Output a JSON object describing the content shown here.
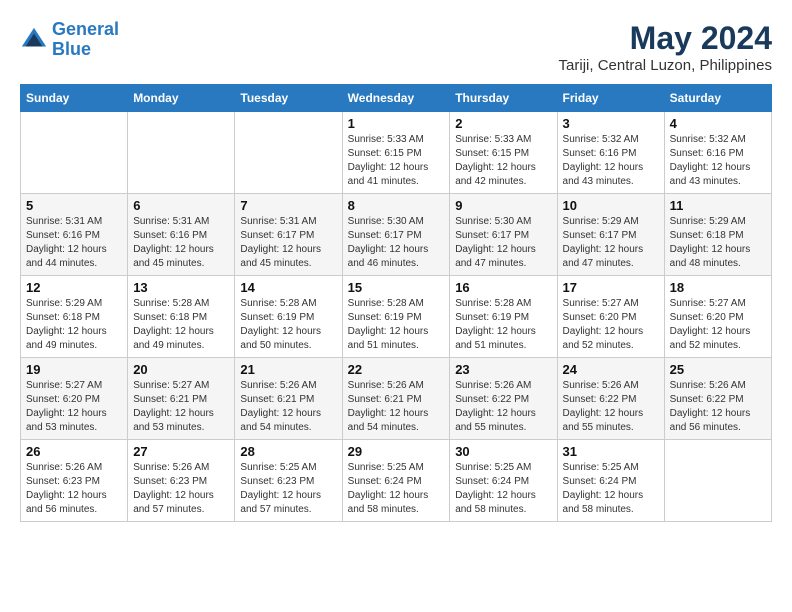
{
  "header": {
    "logo_line1": "General",
    "logo_line2": "Blue",
    "title": "May 2024",
    "subtitle": "Tariji, Central Luzon, Philippines"
  },
  "days_of_week": [
    "Sunday",
    "Monday",
    "Tuesday",
    "Wednesday",
    "Thursday",
    "Friday",
    "Saturday"
  ],
  "weeks": [
    [
      {
        "day": "",
        "info": ""
      },
      {
        "day": "",
        "info": ""
      },
      {
        "day": "",
        "info": ""
      },
      {
        "day": "1",
        "info": "Sunrise: 5:33 AM\nSunset: 6:15 PM\nDaylight: 12 hours\nand 41 minutes."
      },
      {
        "day": "2",
        "info": "Sunrise: 5:33 AM\nSunset: 6:15 PM\nDaylight: 12 hours\nand 42 minutes."
      },
      {
        "day": "3",
        "info": "Sunrise: 5:32 AM\nSunset: 6:16 PM\nDaylight: 12 hours\nand 43 minutes."
      },
      {
        "day": "4",
        "info": "Sunrise: 5:32 AM\nSunset: 6:16 PM\nDaylight: 12 hours\nand 43 minutes."
      }
    ],
    [
      {
        "day": "5",
        "info": "Sunrise: 5:31 AM\nSunset: 6:16 PM\nDaylight: 12 hours\nand 44 minutes."
      },
      {
        "day": "6",
        "info": "Sunrise: 5:31 AM\nSunset: 6:16 PM\nDaylight: 12 hours\nand 45 minutes."
      },
      {
        "day": "7",
        "info": "Sunrise: 5:31 AM\nSunset: 6:17 PM\nDaylight: 12 hours\nand 45 minutes."
      },
      {
        "day": "8",
        "info": "Sunrise: 5:30 AM\nSunset: 6:17 PM\nDaylight: 12 hours\nand 46 minutes."
      },
      {
        "day": "9",
        "info": "Sunrise: 5:30 AM\nSunset: 6:17 PM\nDaylight: 12 hours\nand 47 minutes."
      },
      {
        "day": "10",
        "info": "Sunrise: 5:29 AM\nSunset: 6:17 PM\nDaylight: 12 hours\nand 47 minutes."
      },
      {
        "day": "11",
        "info": "Sunrise: 5:29 AM\nSunset: 6:18 PM\nDaylight: 12 hours\nand 48 minutes."
      }
    ],
    [
      {
        "day": "12",
        "info": "Sunrise: 5:29 AM\nSunset: 6:18 PM\nDaylight: 12 hours\nand 49 minutes."
      },
      {
        "day": "13",
        "info": "Sunrise: 5:28 AM\nSunset: 6:18 PM\nDaylight: 12 hours\nand 49 minutes."
      },
      {
        "day": "14",
        "info": "Sunrise: 5:28 AM\nSunset: 6:19 PM\nDaylight: 12 hours\nand 50 minutes."
      },
      {
        "day": "15",
        "info": "Sunrise: 5:28 AM\nSunset: 6:19 PM\nDaylight: 12 hours\nand 51 minutes."
      },
      {
        "day": "16",
        "info": "Sunrise: 5:28 AM\nSunset: 6:19 PM\nDaylight: 12 hours\nand 51 minutes."
      },
      {
        "day": "17",
        "info": "Sunrise: 5:27 AM\nSunset: 6:20 PM\nDaylight: 12 hours\nand 52 minutes."
      },
      {
        "day": "18",
        "info": "Sunrise: 5:27 AM\nSunset: 6:20 PM\nDaylight: 12 hours\nand 52 minutes."
      }
    ],
    [
      {
        "day": "19",
        "info": "Sunrise: 5:27 AM\nSunset: 6:20 PM\nDaylight: 12 hours\nand 53 minutes."
      },
      {
        "day": "20",
        "info": "Sunrise: 5:27 AM\nSunset: 6:21 PM\nDaylight: 12 hours\nand 53 minutes."
      },
      {
        "day": "21",
        "info": "Sunrise: 5:26 AM\nSunset: 6:21 PM\nDaylight: 12 hours\nand 54 minutes."
      },
      {
        "day": "22",
        "info": "Sunrise: 5:26 AM\nSunset: 6:21 PM\nDaylight: 12 hours\nand 54 minutes."
      },
      {
        "day": "23",
        "info": "Sunrise: 5:26 AM\nSunset: 6:22 PM\nDaylight: 12 hours\nand 55 minutes."
      },
      {
        "day": "24",
        "info": "Sunrise: 5:26 AM\nSunset: 6:22 PM\nDaylight: 12 hours\nand 55 minutes."
      },
      {
        "day": "25",
        "info": "Sunrise: 5:26 AM\nSunset: 6:22 PM\nDaylight: 12 hours\nand 56 minutes."
      }
    ],
    [
      {
        "day": "26",
        "info": "Sunrise: 5:26 AM\nSunset: 6:23 PM\nDaylight: 12 hours\nand 56 minutes."
      },
      {
        "day": "27",
        "info": "Sunrise: 5:26 AM\nSunset: 6:23 PM\nDaylight: 12 hours\nand 57 minutes."
      },
      {
        "day": "28",
        "info": "Sunrise: 5:25 AM\nSunset: 6:23 PM\nDaylight: 12 hours\nand 57 minutes."
      },
      {
        "day": "29",
        "info": "Sunrise: 5:25 AM\nSunset: 6:24 PM\nDaylight: 12 hours\nand 58 minutes."
      },
      {
        "day": "30",
        "info": "Sunrise: 5:25 AM\nSunset: 6:24 PM\nDaylight: 12 hours\nand 58 minutes."
      },
      {
        "day": "31",
        "info": "Sunrise: 5:25 AM\nSunset: 6:24 PM\nDaylight: 12 hours\nand 58 minutes."
      },
      {
        "day": "",
        "info": ""
      }
    ]
  ]
}
